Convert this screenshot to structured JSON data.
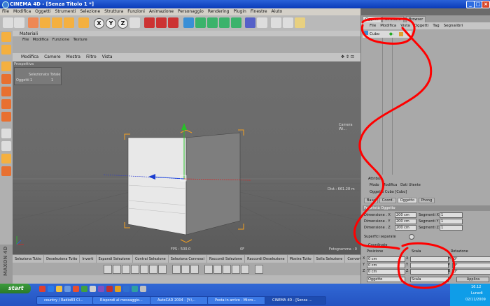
{
  "window": {
    "title": "CINEMA 4D - [Senza Titolo 1 *]"
  },
  "menubar": [
    "File",
    "Modifica",
    "Oggetti",
    "Strumenti",
    "Selezione",
    "Struttura",
    "Funzioni",
    "Animazione",
    "Personaggio",
    "Rendering",
    "Plugin",
    "Finestre",
    "Aiuto"
  ],
  "toolbar": {
    "coord_buttons": [
      "X",
      "Y",
      "Z"
    ]
  },
  "materials": {
    "title": "Materiali",
    "menu": [
      "File",
      "Modifica",
      "Funzione",
      "Texture"
    ]
  },
  "viewport": {
    "menu": [
      "Modifica",
      "Camere",
      "Mostra",
      "Filtro",
      "Vista"
    ],
    "label": "Prospettiva",
    "info": {
      "header": "Selezionato Totale",
      "row_label": "Oggetti",
      "selected": "1",
      "total": "1"
    },
    "camera_label": "Camera Wi...",
    "distance": "Dist.: 661.28 m",
    "fps": "FPS : 500.0",
    "bf": "0F",
    "frame": "Fotogramma : 0"
  },
  "selection_bar": [
    "Seleziona Tutto",
    "Deseleziona Tutto",
    "Inverti",
    "Espandi Selezione",
    "Contrai Selezione",
    "Seleziona Connessi",
    "Raccordi Selezione",
    "Raccordi Deselezione",
    "Mostra Tutto",
    "Sella Selezione",
    "Converti Sele..."
  ],
  "objects": {
    "tabs": [
      "Oggetti",
      "Struttura",
      "Browser"
    ],
    "menu": [
      "File",
      "Modifica",
      "Vista",
      "Oggetti",
      "Tag",
      "Segnalibri"
    ],
    "items": [
      {
        "name": "Cubo"
      }
    ]
  },
  "attributes": {
    "title": "Attributi",
    "menu": [
      "Modo",
      "Modifica",
      "Dati Utente"
    ],
    "object_title": "Oggetto Cubo [Cubo]",
    "tabs": [
      "Base",
      "Coord.",
      "Oggetto",
      "Phong"
    ],
    "section": "Proprietà Oggetto",
    "dimensions": [
      {
        "label": "Dimensione . X",
        "value": "200 cm",
        "seg_label": "Segmenti X",
        "seg": "1"
      },
      {
        "label": "Dimensione . Y",
        "value": "200 cm",
        "seg_label": "Segmenti Y",
        "seg": "1"
      },
      {
        "label": "Dimensione . Z",
        "value": "200 cm",
        "seg_label": "Segmenti Z",
        "seg": "1"
      }
    ],
    "separate": "Superfici separate"
  },
  "coordinates": {
    "title": "Coordinate",
    "headers": [
      "Posizione",
      "Scala",
      "Rotazione"
    ],
    "rows": [
      {
        "axis": "X",
        "pos": "0 cm",
        "scale_axis": "X",
        "scale": "",
        "rot_axis": "H",
        "rot": "0°"
      },
      {
        "axis": "Y",
        "pos": "0 cm",
        "scale_axis": "Y",
        "scale": "",
        "rot_axis": "P",
        "rot": "0°"
      },
      {
        "axis": "Z",
        "pos": "0 cm",
        "scale_axis": "Z",
        "scale": "",
        "rot_axis": "B",
        "rot": "0°"
      }
    ],
    "mode_left": "Oggetto",
    "mode_mid": "Scala",
    "apply": "Applica"
  },
  "taskbar": {
    "start": "start",
    "tasks": [
      "country / Radio83 Cl...",
      "Rispondi al messaggio...",
      "AutoCAD 2004 - [Y:\\...",
      "Posta in arrivo - Micro...",
      "CINEMA 4D - [Senza ..."
    ],
    "time": "16.12",
    "day": "Lunedì",
    "date": "02/11/2009"
  },
  "colors": {
    "scribble": "#ff0000",
    "title_bar": "#0a3bb8",
    "panel": "#a9a9a9",
    "taskbar": "#2453c1"
  }
}
